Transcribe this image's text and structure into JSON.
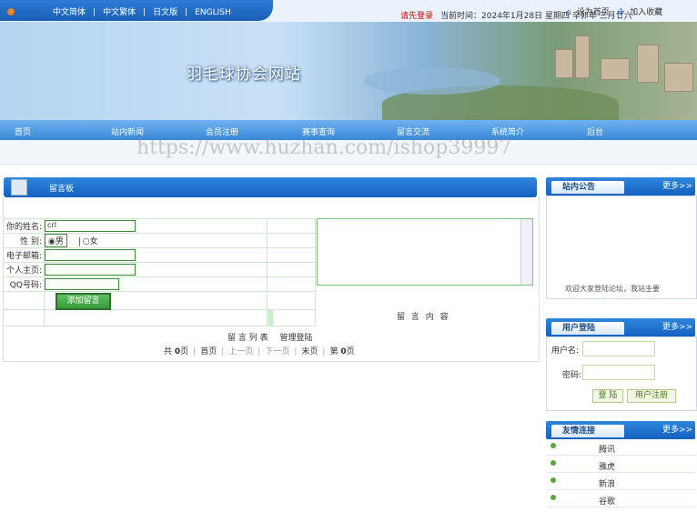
{
  "top": {
    "languages": [
      "中文简体",
      "|",
      "中文繁体",
      "|",
      "日文版",
      "|",
      "ENGLISH"
    ],
    "set_home": "设为首页",
    "add_fav": "加入收藏"
  },
  "banner": {
    "title": "羽毛球协会网站"
  },
  "nav": [
    "首页",
    "站内新闻",
    "会员注册",
    "赛事查询",
    "留言交流",
    "系统简介",
    "后台"
  ],
  "ticker": {
    "login_link": "请先登录",
    "date_text": "当前时间：2024年1月28日 星期四 辛卯年 三月廿六"
  },
  "watermark": "https://www.huzhan.com/ishop39997",
  "board": {
    "title": "留言板",
    "name_label": "你的姓名:",
    "name_value": "crl",
    "gender_label": "性  别:",
    "male": "男",
    "female": "女",
    "email_label": "电子邮箱:",
    "homepage_label": "个人主页:",
    "qq_label": "QQ号码:",
    "add_button": "添加留言",
    "content_label": "留 言 内 容",
    "list_link": "留 言 列 表",
    "admin_link": "管理登陆",
    "pager": {
      "total_prefix": "共",
      "total": "0",
      "total_suffix": "页",
      "first": "首页",
      "prev": "上一页",
      "next": "下一页",
      "last": "末页",
      "page_prefix": "第",
      "page": "0",
      "page_suffix": "页"
    }
  },
  "notice": {
    "title": "站内公告",
    "more": "更多>>",
    "text": "欢迎大家登陆论坛，我站主要"
  },
  "login": {
    "title": "用户登陆",
    "more": "更多>>",
    "user_label": "用户名:",
    "pass_label": "密码:",
    "login_btn": "登 陆",
    "register_btn": "用户注册"
  },
  "links": {
    "title": "友情连接",
    "more": "更多>>",
    "items": [
      "腾讯",
      "雅虎",
      "新浪",
      "谷歌"
    ]
  }
}
